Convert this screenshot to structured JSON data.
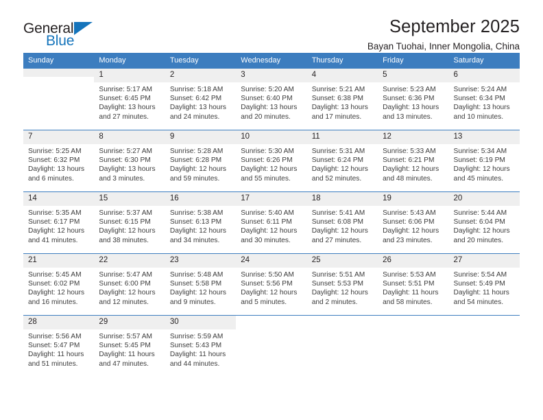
{
  "brand": {
    "name_part1": "General",
    "name_part2": "Blue",
    "color_primary": "#1574bb",
    "color_text": "#231f20"
  },
  "header": {
    "title": "September 2025",
    "subtitle": "Bayan Tuohai, Inner Mongolia, China"
  },
  "calendar": {
    "header_bg": "#3c7dbf",
    "daynum_bg": "#efefef",
    "weekday_headers": [
      "Sunday",
      "Monday",
      "Tuesday",
      "Wednesday",
      "Thursday",
      "Friday",
      "Saturday"
    ],
    "weeks": [
      [
        {
          "day": "",
          "lines": []
        },
        {
          "day": "1",
          "lines": [
            "Sunrise: 5:17 AM",
            "Sunset: 6:45 PM",
            "Daylight: 13 hours",
            "and 27 minutes."
          ]
        },
        {
          "day": "2",
          "lines": [
            "Sunrise: 5:18 AM",
            "Sunset: 6:42 PM",
            "Daylight: 13 hours",
            "and 24 minutes."
          ]
        },
        {
          "day": "3",
          "lines": [
            "Sunrise: 5:20 AM",
            "Sunset: 6:40 PM",
            "Daylight: 13 hours",
            "and 20 minutes."
          ]
        },
        {
          "day": "4",
          "lines": [
            "Sunrise: 5:21 AM",
            "Sunset: 6:38 PM",
            "Daylight: 13 hours",
            "and 17 minutes."
          ]
        },
        {
          "day": "5",
          "lines": [
            "Sunrise: 5:23 AM",
            "Sunset: 6:36 PM",
            "Daylight: 13 hours",
            "and 13 minutes."
          ]
        },
        {
          "day": "6",
          "lines": [
            "Sunrise: 5:24 AM",
            "Sunset: 6:34 PM",
            "Daylight: 13 hours",
            "and 10 minutes."
          ]
        }
      ],
      [
        {
          "day": "7",
          "lines": [
            "Sunrise: 5:25 AM",
            "Sunset: 6:32 PM",
            "Daylight: 13 hours",
            "and 6 minutes."
          ]
        },
        {
          "day": "8",
          "lines": [
            "Sunrise: 5:27 AM",
            "Sunset: 6:30 PM",
            "Daylight: 13 hours",
            "and 3 minutes."
          ]
        },
        {
          "day": "9",
          "lines": [
            "Sunrise: 5:28 AM",
            "Sunset: 6:28 PM",
            "Daylight: 12 hours",
            "and 59 minutes."
          ]
        },
        {
          "day": "10",
          "lines": [
            "Sunrise: 5:30 AM",
            "Sunset: 6:26 PM",
            "Daylight: 12 hours",
            "and 55 minutes."
          ]
        },
        {
          "day": "11",
          "lines": [
            "Sunrise: 5:31 AM",
            "Sunset: 6:24 PM",
            "Daylight: 12 hours",
            "and 52 minutes."
          ]
        },
        {
          "day": "12",
          "lines": [
            "Sunrise: 5:33 AM",
            "Sunset: 6:21 PM",
            "Daylight: 12 hours",
            "and 48 minutes."
          ]
        },
        {
          "day": "13",
          "lines": [
            "Sunrise: 5:34 AM",
            "Sunset: 6:19 PM",
            "Daylight: 12 hours",
            "and 45 minutes."
          ]
        }
      ],
      [
        {
          "day": "14",
          "lines": [
            "Sunrise: 5:35 AM",
            "Sunset: 6:17 PM",
            "Daylight: 12 hours",
            "and 41 minutes."
          ]
        },
        {
          "day": "15",
          "lines": [
            "Sunrise: 5:37 AM",
            "Sunset: 6:15 PM",
            "Daylight: 12 hours",
            "and 38 minutes."
          ]
        },
        {
          "day": "16",
          "lines": [
            "Sunrise: 5:38 AM",
            "Sunset: 6:13 PM",
            "Daylight: 12 hours",
            "and 34 minutes."
          ]
        },
        {
          "day": "17",
          "lines": [
            "Sunrise: 5:40 AM",
            "Sunset: 6:11 PM",
            "Daylight: 12 hours",
            "and 30 minutes."
          ]
        },
        {
          "day": "18",
          "lines": [
            "Sunrise: 5:41 AM",
            "Sunset: 6:08 PM",
            "Daylight: 12 hours",
            "and 27 minutes."
          ]
        },
        {
          "day": "19",
          "lines": [
            "Sunrise: 5:43 AM",
            "Sunset: 6:06 PM",
            "Daylight: 12 hours",
            "and 23 minutes."
          ]
        },
        {
          "day": "20",
          "lines": [
            "Sunrise: 5:44 AM",
            "Sunset: 6:04 PM",
            "Daylight: 12 hours",
            "and 20 minutes."
          ]
        }
      ],
      [
        {
          "day": "21",
          "lines": [
            "Sunrise: 5:45 AM",
            "Sunset: 6:02 PM",
            "Daylight: 12 hours",
            "and 16 minutes."
          ]
        },
        {
          "day": "22",
          "lines": [
            "Sunrise: 5:47 AM",
            "Sunset: 6:00 PM",
            "Daylight: 12 hours",
            "and 12 minutes."
          ]
        },
        {
          "day": "23",
          "lines": [
            "Sunrise: 5:48 AM",
            "Sunset: 5:58 PM",
            "Daylight: 12 hours",
            "and 9 minutes."
          ]
        },
        {
          "day": "24",
          "lines": [
            "Sunrise: 5:50 AM",
            "Sunset: 5:56 PM",
            "Daylight: 12 hours",
            "and 5 minutes."
          ]
        },
        {
          "day": "25",
          "lines": [
            "Sunrise: 5:51 AM",
            "Sunset: 5:53 PM",
            "Daylight: 12 hours",
            "and 2 minutes."
          ]
        },
        {
          "day": "26",
          "lines": [
            "Sunrise: 5:53 AM",
            "Sunset: 5:51 PM",
            "Daylight: 11 hours",
            "and 58 minutes."
          ]
        },
        {
          "day": "27",
          "lines": [
            "Sunrise: 5:54 AM",
            "Sunset: 5:49 PM",
            "Daylight: 11 hours",
            "and 54 minutes."
          ]
        }
      ],
      [
        {
          "day": "28",
          "lines": [
            "Sunrise: 5:56 AM",
            "Sunset: 5:47 PM",
            "Daylight: 11 hours",
            "and 51 minutes."
          ]
        },
        {
          "day": "29",
          "lines": [
            "Sunrise: 5:57 AM",
            "Sunset: 5:45 PM",
            "Daylight: 11 hours",
            "and 47 minutes."
          ]
        },
        {
          "day": "30",
          "lines": [
            "Sunrise: 5:59 AM",
            "Sunset: 5:43 PM",
            "Daylight: 11 hours",
            "and 44 minutes."
          ]
        },
        {
          "day": "",
          "lines": []
        },
        {
          "day": "",
          "lines": []
        },
        {
          "day": "",
          "lines": []
        },
        {
          "day": "",
          "lines": []
        }
      ]
    ]
  }
}
